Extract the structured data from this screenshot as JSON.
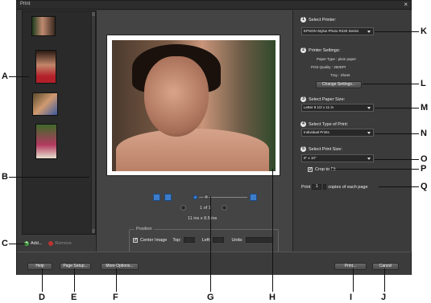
{
  "dialog": {
    "title": "Print",
    "close_glyph": "×"
  },
  "left": {
    "add_label": "Add...",
    "remove_label": "Remove"
  },
  "preview": {
    "page_info": "1 of 1",
    "paper_size": "11 ins x 8.5 ins",
    "position_legend": "Position",
    "center_image_label": "Center Image",
    "top_label": "Top:",
    "left_label": "Left:",
    "units_label": "Units:"
  },
  "right": {
    "step1": {
      "num": "1",
      "label": "Select Printer:",
      "value": "EPSON Stylus Photo R230 Series"
    },
    "step2": {
      "num": "2",
      "label": "Printer Settings:",
      "paper_type": "Paper Type : plain paper",
      "print_quality": "Print Quality : 360DPI",
      "tray": "Tray : Sheet",
      "button": "Change Settings..."
    },
    "step3": {
      "num": "3",
      "label": "Select Paper Size:",
      "value": "Letter 8 1/2 x 11 in"
    },
    "step4": {
      "num": "4",
      "label": "Select Type of Print:",
      "value": "Individual Prints"
    },
    "step5": {
      "num": "5",
      "label": "Select Print Size:",
      "value": "8\" x 10\""
    },
    "crop_label": "Crop to Fit",
    "print_label": "Print",
    "copies_value": "1",
    "copies_suffix": "copies of each page"
  },
  "bottom": {
    "help": "Help",
    "page_setup": "Page Setup...",
    "more_options": "More Options...",
    "print": "Print...",
    "cancel": "Cancel"
  },
  "callouts": {
    "A": "A",
    "B": "B",
    "C": "C",
    "D": "D",
    "E": "E",
    "F": "F",
    "G": "G",
    "H": "H",
    "I": "I",
    "J": "J",
    "K": "K",
    "L": "L",
    "M": "M",
    "N": "N",
    "O": "O",
    "P": "P",
    "Q": "Q"
  }
}
